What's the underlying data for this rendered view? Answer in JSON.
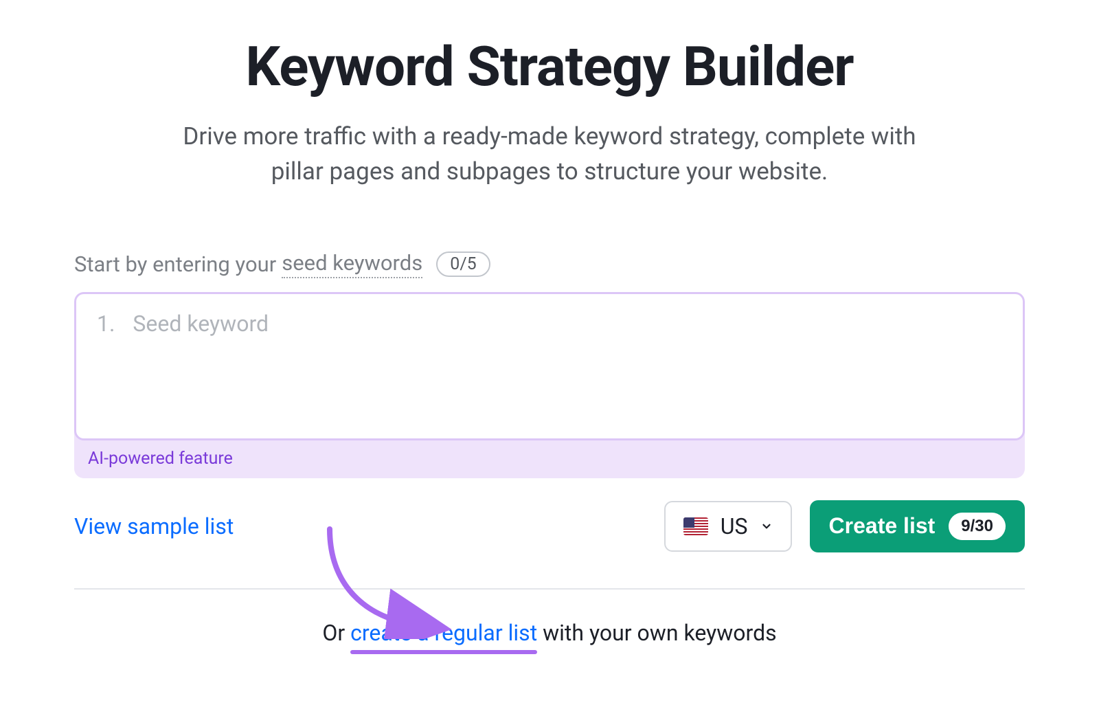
{
  "header": {
    "title": "Keyword Strategy Builder",
    "subtitle": "Drive more traffic with a ready-made keyword strategy, complete with pillar pages and subpages to structure your website."
  },
  "input": {
    "prompt_prefix": "Start by entering your ",
    "prompt_underlined": "seed keywords",
    "count_badge": "0/5",
    "index": "1.",
    "placeholder": "Seed keyword",
    "ai_label": "AI-powered feature"
  },
  "controls": {
    "sample_link": "View sample list",
    "country_code": "US",
    "create_label": "Create list",
    "create_count": "9/30"
  },
  "alt": {
    "prefix": "Or ",
    "link": "create a regular list",
    "suffix": " with your own keywords"
  }
}
